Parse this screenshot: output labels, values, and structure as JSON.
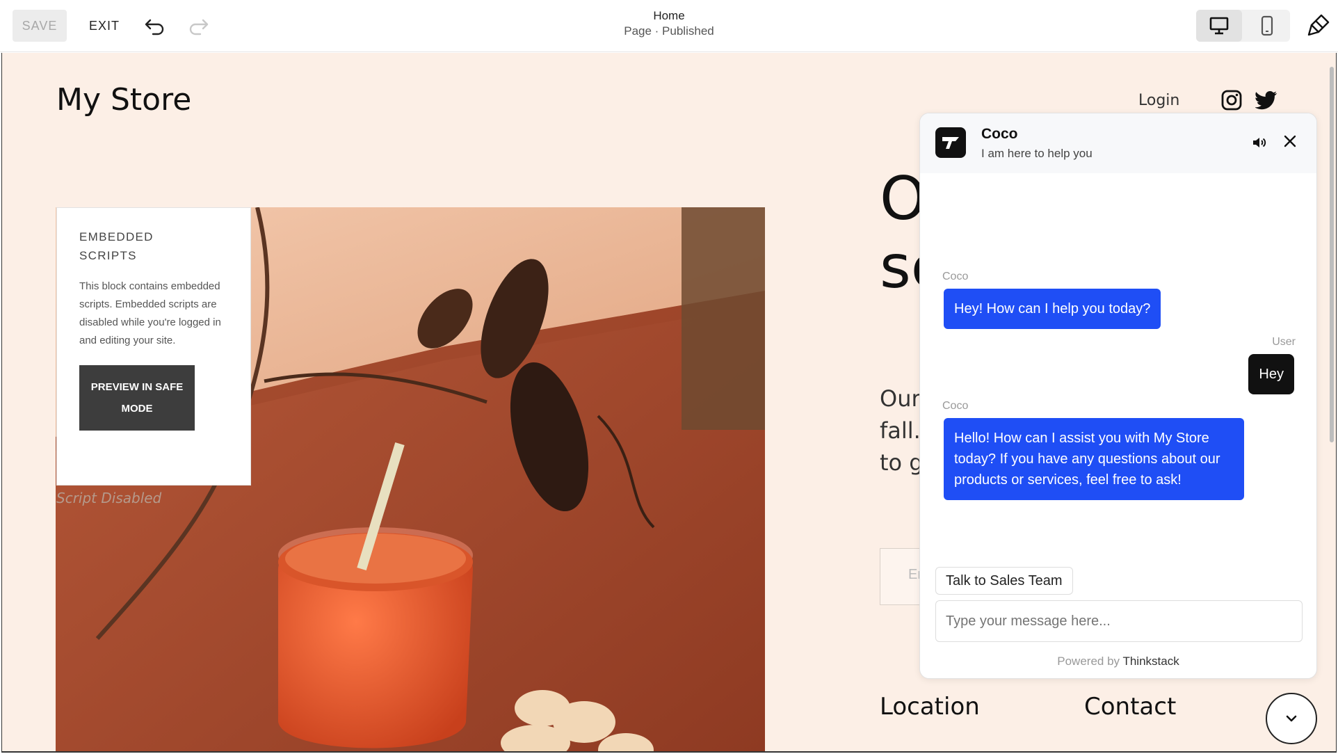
{
  "toolbar": {
    "save_label": "SAVE",
    "exit_label": "EXIT",
    "page_title": "Home",
    "page_status": "Page · Published"
  },
  "site": {
    "store_title": "My Store",
    "login_label": "Login",
    "embedded": {
      "title_line1": "EMBEDDED",
      "title_line2": "SCRIPTS",
      "text": "This block contains embedded scripts. Embedded scripts are disabled while you're logged in and editing your site.",
      "button_label": "PREVIEW IN SAFE MODE"
    },
    "script_disabled": "Script Disabled",
    "hero": {
      "big_line1": "O",
      "big_line2": "sc",
      "text_line1": "Our",
      "text_line2": "fall.",
      "text_line3": "to g"
    },
    "email_placeholder": "En",
    "footer": {
      "location": "Location",
      "contact": "Contact"
    }
  },
  "chat": {
    "bot_name": "Coco",
    "tagline": "I am here to help you",
    "messages": [
      {
        "sender": "Coco",
        "text": "Hey! How can I help you today?"
      },
      {
        "sender": "User",
        "text": "Hey"
      },
      {
        "sender": "Coco",
        "text": "Hello! How can I assist you with My Store today? If you have any questions about our products or services, feel free to ask!"
      }
    ],
    "quick_reply": "Talk to Sales Team",
    "input_placeholder": "Type your message here...",
    "powered_by": "Powered by",
    "powered_brand": "Thinkstack"
  },
  "icons": {
    "undo": "undo-icon",
    "redo": "redo-icon",
    "desktop": "desktop-icon",
    "mobile": "mobile-icon",
    "design": "paintbrush-icon",
    "instagram": "instagram-icon",
    "twitter": "twitter-icon",
    "sound": "speaker-icon",
    "close": "close-icon",
    "scroll": "chevron-down-icon"
  },
  "colors": {
    "site_background": "#fcefe6",
    "chat_bot_bubble": "#1f4ef5",
    "chat_user_bubble": "#111111",
    "embedded_button": "#3d3d3d"
  }
}
